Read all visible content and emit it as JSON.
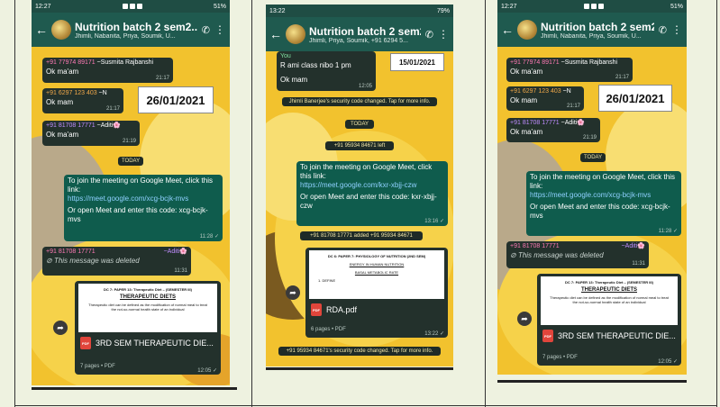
{
  "phones": [
    {
      "status_time": "12:27",
      "battery": "51%",
      "group_title": "Nutrition batch 2 sem2...",
      "group_subtitle": "Jhimli, Nabanita, Priya, Soumik, U...",
      "date_label": "26/01/2021",
      "msgs": [
        {
          "sender": "+91 77974 89171",
          "alias": "~Susmita Rajbanshi",
          "text": "Ok ma'am",
          "time": "21:17"
        },
        {
          "sender": "+91 6297 123 403",
          "alias": "~N",
          "text": "Ok mam",
          "time": "21:17"
        },
        {
          "sender": "+91 81708 17771",
          "alias": "~Aditi🌸",
          "text": "Ok ma'am",
          "time": "21:19"
        }
      ],
      "today": "TODAY",
      "meet_line1": "To join the meeting on Google Meet, click this link:",
      "meet_link": "https://meet.google.com/xcg-bcjk-mvs",
      "meet_line2": "Or open Meet and enter this code: xcg-bcjk-mvs",
      "meet_time": "11:28 ✓",
      "del_sender": "+91 81708 17771",
      "del_alias": "~Aditi🌸",
      "deleted_text": "This message was deleted",
      "del_time": "11:31",
      "doc_header": "DC 7: PAPER 13: Therapeutic Diet – (SEMESTER III)",
      "doc_title": "THERAPEUTIC DIETS",
      "doc_body": "Therapeutic diet can be defined as the modification of normal meal to treat the not-so-normal health state of an individual",
      "pdf_name": "3RD SEM THERAPEUTIC DIE...",
      "doc_meta": "7 pages • PDF",
      "doc_time": "12:05 ✓"
    },
    {
      "status_time": "13:22",
      "battery": "79%",
      "group_title": "Nutrition batch 2 sem2...",
      "group_subtitle": "Jhimli, Priya, Soumik, +91 6294 5...",
      "date_label": "15/01/2021",
      "you_label": "You",
      "you_text": "R ami class nibo 1 pm",
      "ok_text": "Ok mam",
      "ok_time": "12:05",
      "sys1": "Jhimli Banerjee's security code changed. Tap for more info.",
      "today": "TODAY",
      "sys2": "+91 95934 84671 left",
      "meet_line1": "To join the meeting on Google Meet, click this link:",
      "meet_link": "https://meet.google.com/kxr-xbjj-czw",
      "meet_line2": "Or open Meet and enter this code: kxr-xbjj-czw",
      "meet_time": "13:16 ✓",
      "sys3": "+91 81708 17771 added +91 95934 84671",
      "doc_header": "DC 6: PAPER 7: PHYSIOLOGY OF NUTRITION (2ND SEM)",
      "doc_line2": "ENERGY IN HUMAN NUTRITION",
      "doc_line3": "BASAL METABOLIC RATE",
      "doc_line4": "1. DEFINE",
      "pdf_name": "RDA.pdf",
      "doc_meta": "6 pages • PDF",
      "doc_time": "13:22 ✓",
      "sys4": "+91 95934 84671's security code changed. Tap for more info."
    },
    {
      "status_time": "12:27",
      "battery": "51%",
      "group_title": "Nutrition batch 2 sem2...",
      "group_subtitle": "Jhimli, Nabanita, Priya, Soumik, U...",
      "date_label": "26/01/2021",
      "msgs": [
        {
          "sender": "+91 77974 89171",
          "alias": "~Susmita Rajbanshi",
          "text": "Ok ma'am",
          "time": "21:17"
        },
        {
          "sender": "+91 6297 123 403",
          "alias": "~N",
          "text": "Ok mam",
          "time": "21:17"
        },
        {
          "sender": "+91 81708 17771",
          "alias": "~Aditi🌸",
          "text": "Ok ma'am",
          "time": "21:19"
        }
      ],
      "today": "TODAY",
      "meet_line1": "To join the meeting on Google Meet, click this link:",
      "meet_link": "https://meet.google.com/xcg-bcjk-mvs",
      "meet_line2": "Or open Meet and enter this code: xcg-bcjk-mvs",
      "meet_time": "11:28 ✓",
      "del_sender": "+91 81708 17771",
      "del_alias": "~Aditi🌸",
      "deleted_text": "This message was deleted",
      "del_time": "11:31",
      "doc_header": "DC 7: PAPER 13: Therapeutic Diet – (SEMESTER III)",
      "doc_title": "THERAPEUTIC DIETS",
      "doc_body": "Therapeutic diet can be defined as the modification of normal meal to treat the not-so-normal health state of an individual",
      "pdf_name": "3RD SEM THERAPEUTIC DIE...",
      "doc_meta": "7 pages • PDF",
      "doc_time": "12:05 ✓"
    }
  ],
  "colors": {
    "appbar": "#1f5a4f",
    "incoming": "#23312c",
    "outgoing": "#0f5c4d",
    "wallpaper": "#f2c22e"
  }
}
